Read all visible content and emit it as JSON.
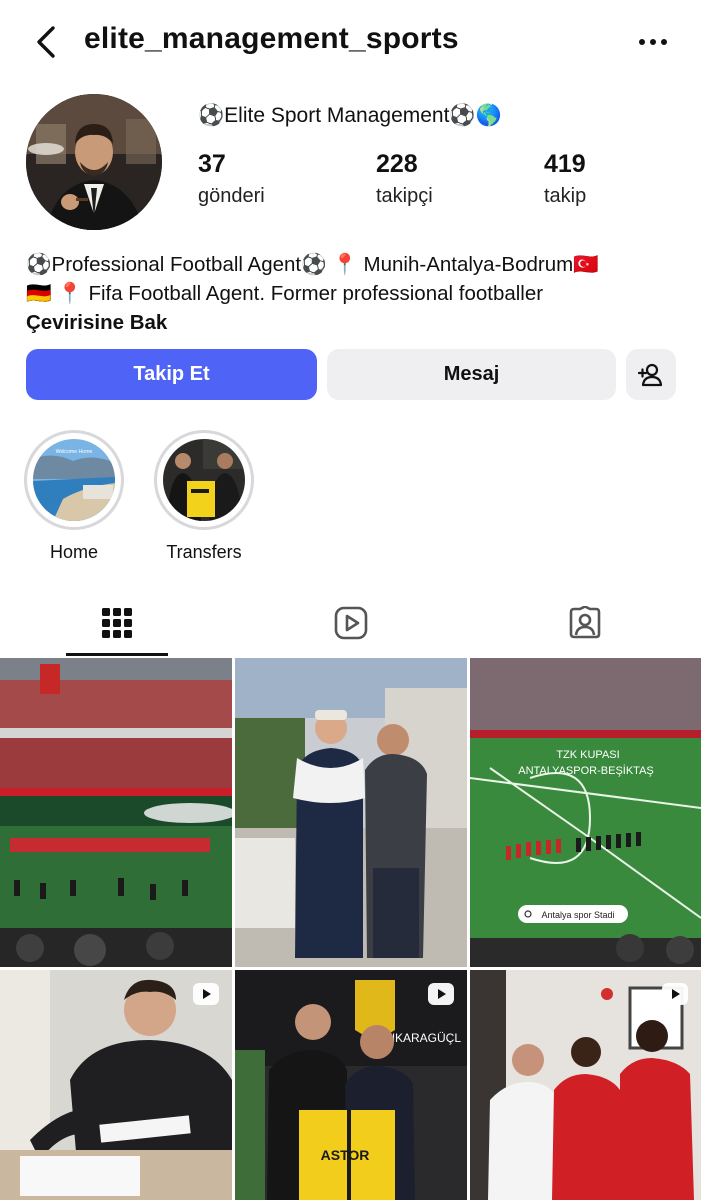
{
  "header": {
    "username": "elite_management_sports",
    "back_icon": "chevron-left-icon",
    "more_icon": "more-horizontal-icon"
  },
  "profile": {
    "display_name": "⚽Elite Sport Management⚽🌎",
    "stats": [
      {
        "value": "37",
        "label": "gönderi"
      },
      {
        "value": "228",
        "label": "takipçi"
      },
      {
        "value": "419",
        "label": "takip"
      }
    ],
    "bio_lines": [
      "⚽Professional Football Agent⚽ 📍 Munih-Antalya-Bodrum🇹🇷",
      "🇩🇪 📍 Fifa Football Agent. Former professional footballer"
    ],
    "translate_label": "Çevirisine Bak"
  },
  "actions": {
    "follow_label": "Takip Et",
    "message_label": "Mesaj",
    "add_user_icon": "add-person-icon",
    "accent_color": "#4f64f6"
  },
  "highlights": [
    {
      "label": "Home",
      "cover_text": "Welcome Home"
    },
    {
      "label": "Transfers"
    }
  ],
  "tabs": [
    {
      "icon": "grid-icon",
      "active": true
    },
    {
      "icon": "reels-icon",
      "active": false
    },
    {
      "icon": "tagged-icon",
      "active": false
    }
  ],
  "posts": [
    {
      "type": "photo",
      "subject": "stadium-stands"
    },
    {
      "type": "photo",
      "subject": "two-men-office"
    },
    {
      "type": "photo",
      "subject": "pitch-lineup",
      "overlay_title": "TZK KUPASI",
      "overlay_subtitle": "ANTALYASPOR-BEŞİKTAŞ",
      "location_tag": "Antalya spor Stadi"
    },
    {
      "type": "reel",
      "subject": "contract-signing"
    },
    {
      "type": "reel",
      "subject": "jersey-presentation",
      "jersey_text": "ASTOR",
      "wall_text": "ANKARAGÜÇL"
    },
    {
      "type": "reel",
      "subject": "players-red-kits"
    }
  ]
}
